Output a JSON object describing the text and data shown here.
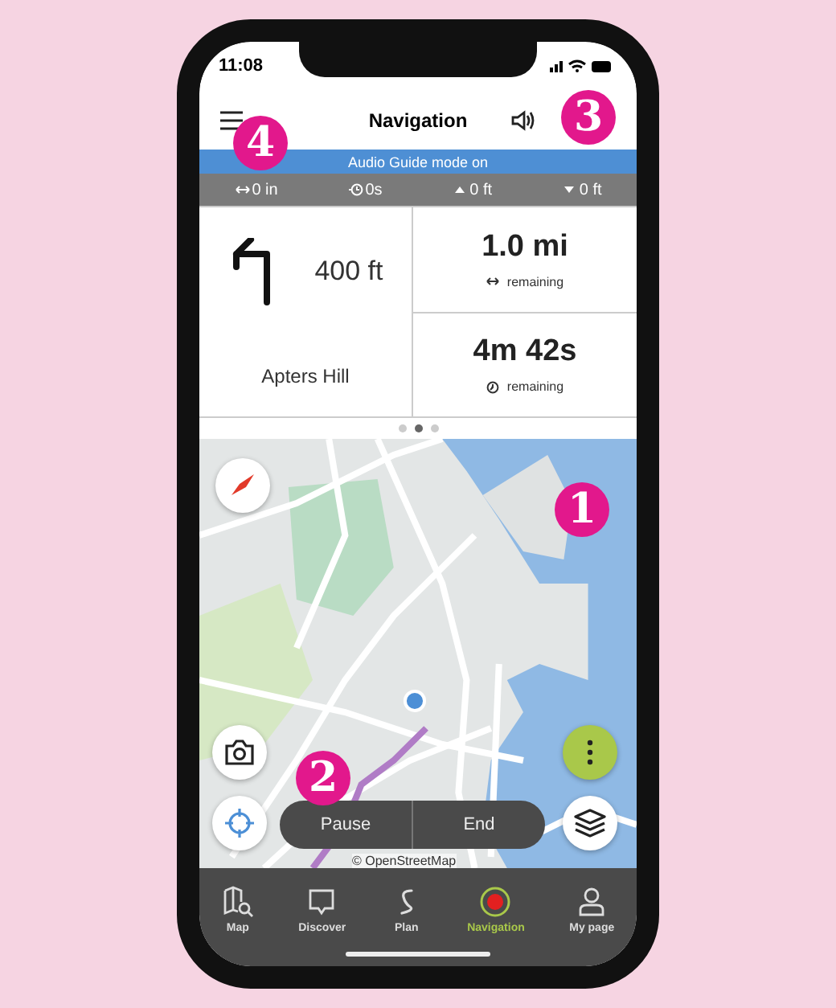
{
  "status_bar": {
    "time": "11:08"
  },
  "header": {
    "title": "Navigation"
  },
  "banner": "Audio Guide mode on",
  "stats": [
    {
      "kind": "distance",
      "value": "0 in"
    },
    {
      "kind": "time",
      "value": "0s"
    },
    {
      "kind": "ascent",
      "value": "0 ft"
    },
    {
      "kind": "descent",
      "value": "0 ft"
    }
  ],
  "instruction": {
    "distance": "400 ft",
    "street": "Apters Hill"
  },
  "remaining": [
    {
      "kind": "distance",
      "value": "1.0 mi",
      "label": "remaining"
    },
    {
      "kind": "time",
      "value": "4m 42s",
      "label": "remaining"
    }
  ],
  "pager": [
    {
      "selected": false
    },
    {
      "selected": true
    },
    {
      "selected": false
    }
  ],
  "route_buttons": [
    "Pause",
    "End"
  ],
  "attribution": "© OpenStreetMap",
  "tabs": [
    {
      "kind": "map",
      "label": "Map",
      "selected": false
    },
    {
      "kind": "discover",
      "label": "Discover",
      "selected": false
    },
    {
      "kind": "plan",
      "label": "Plan",
      "selected": false
    },
    {
      "kind": "navigation",
      "label": "Navigation",
      "selected": true
    },
    {
      "kind": "profile",
      "label": "My page",
      "selected": false
    }
  ],
  "callouts": [
    "1",
    "2",
    "3",
    "4"
  ]
}
